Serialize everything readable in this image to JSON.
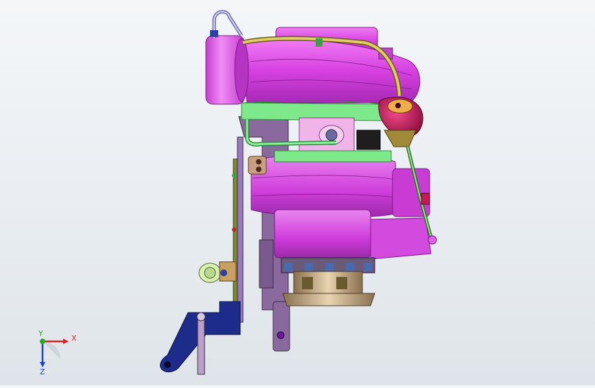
{
  "viewport": {
    "name": "cad-3d-viewport",
    "model": "turbocharger-assembly"
  },
  "triad": {
    "x_label": "X",
    "y_label": "Y",
    "z_label": "Z",
    "x_color": "#e02020",
    "y_color": "#20b020",
    "z_color": "#2040d0"
  },
  "colors": {
    "housing": "#e14fe8",
    "housing_dark": "#b52cc2",
    "clamp_band": "#6fe07a",
    "actuator": "#c8185a",
    "hose": "#c8b24a",
    "bracket_dark": "#1d2c8a",
    "bracket_mount": "#8a6aa0",
    "pulley": "#c8b08a"
  }
}
